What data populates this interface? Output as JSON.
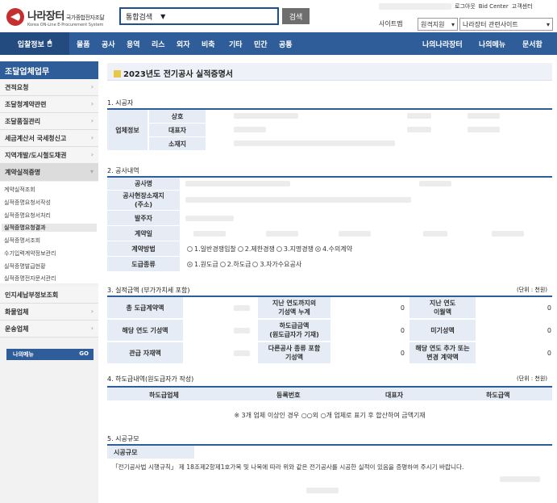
{
  "header": {
    "logo_title": "나라장터",
    "logo_subtitle": "국가종합전자조달",
    "logo_en": "Korea ON-Line E-Procurement System",
    "search_type": "통합검색",
    "search_button": "검색",
    "util_links": [
      "로그아웃",
      "Bid Center",
      "고객센터"
    ],
    "sitemap": "사이트맵",
    "select1": "원격지원",
    "select2": "나라장터 관련사이트"
  },
  "nav": {
    "home": "입찰정보",
    "items": [
      "물품",
      "공사",
      "용역",
      "리스",
      "외자",
      "비축",
      "기타",
      "민간",
      "공통"
    ],
    "right": [
      "나의나라장터",
      "나의메뉴",
      "문서함"
    ]
  },
  "sidebar": {
    "title": "조달업체업무",
    "menus": [
      "견적요청",
      "조달청계약관련",
      "조달품질관리",
      "세금계산서 국세청신고",
      "지역개발/도시철도채권",
      "계약실적증명"
    ],
    "subs": [
      "계약실적조회",
      "실적증명요청서작성",
      "실적증명요청서처리",
      "실적증명요청결과",
      "실적증명서조회",
      "수기입력계약정보관리",
      "실적증명발급현황",
      "실적증명전자문서관리"
    ],
    "menus2": [
      "인지세납부정보조회",
      "화물업체",
      "운송업체"
    ],
    "mymenu": "나의메뉴",
    "mymenu_tag": "GO"
  },
  "main": {
    "title": "2023년도 전기공사 실적증명서",
    "s1": {
      "label": "1. 시공자",
      "group": "업체정보",
      "rows": [
        "상호",
        "대표자",
        "소재지"
      ]
    },
    "s2": {
      "label": "2. 공사내역",
      "rows": [
        "공사명",
        "공사현장소재지\n(주소)",
        "발주자",
        "계약일",
        "계약방법",
        "도급종류"
      ],
      "contract_methods": [
        "1.일반경쟁입찰",
        "2.제한경쟁",
        "3.지명경쟁",
        "4.수의계약"
      ],
      "contract_types": [
        "1.원도급",
        "2.하도급",
        "3.자가수요공사"
      ]
    },
    "s3": {
      "label": "3. 실적금액 (부가가치세 포함)",
      "unit": "(단위 : 천원)",
      "rows": [
        [
          "총 도급계약액",
          "지난 연도까지의\n기성액 누계",
          "0",
          "지난 연도\n이월액",
          "0"
        ],
        [
          "해당 연도 기성액",
          "하도급금액\n(원도급자가 기재)",
          "0",
          "미기성액",
          "0"
        ],
        [
          "관급 자재액",
          "다른공사 종류 포함\n기성액",
          "0",
          "해당 연도 추가 또는\n변경 계약액",
          "0"
        ]
      ]
    },
    "s4": {
      "label": "4. 하도급내역(원도급자가 작성)",
      "unit": "(단위 : 천원)",
      "cols": [
        "하도급업체",
        "등록번호",
        "대표자",
        "하도급액"
      ],
      "note": "※ 3개 업체 이상인 경우 ○○외 ○개 업체로 표기 후 합산하여 금액기재"
    },
    "s5": {
      "label": "5. 시공규모",
      "sub": "시공규모",
      "text": "「전기공사법 시행규칙」 제 18조제2항제1호가목 및 나목에 따라 위와 같은 전기공사를 시공한 실적이 있음을 증명하여 주시기 바랍니다."
    }
  },
  "colors": {
    "accent": "#2f5d9a",
    "header_bg": "#e6ecf5"
  }
}
